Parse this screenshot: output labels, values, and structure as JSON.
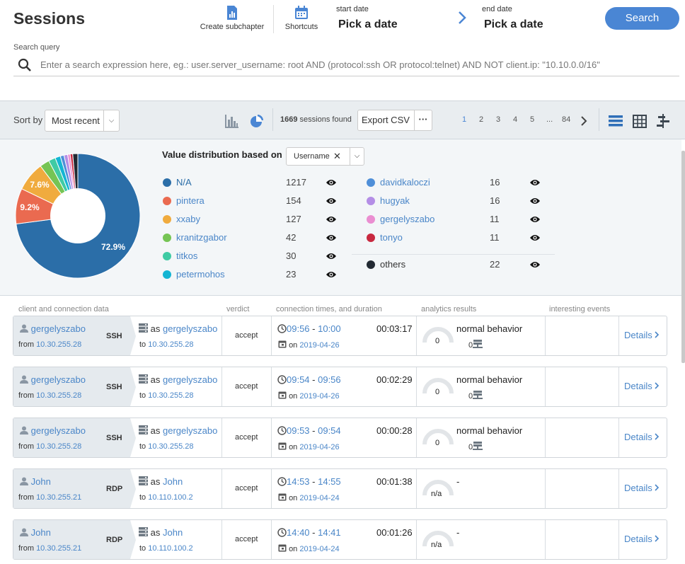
{
  "header": {
    "title": "Sessions",
    "create_subchapter": "Create subchapter",
    "shortcuts": "Shortcuts",
    "start_date_label": "start date",
    "start_date_value": "Pick a date",
    "end_date_label": "end date",
    "end_date_value": "Pick a date",
    "search_button": "Search",
    "search_query_label": "Search query",
    "search_placeholder": "Enter a search expression here, eg.: user.server_username: root AND (protocol:ssh OR protocol:telnet) AND NOT client.ip: \"10.10.0.0/16\""
  },
  "toolbar": {
    "sort_by": "Sort by",
    "sort_value": "Most recent",
    "sessions_count": "1669",
    "sessions_found": "sessions found",
    "export_csv": "Export CSV",
    "more": "···",
    "pages": [
      "1",
      "2",
      "3",
      "4",
      "5",
      "...",
      "84"
    ],
    "current_page": "1"
  },
  "distribution": {
    "label": "Value distribution based on",
    "field": "Username",
    "pie_labels": [
      "72.9%",
      "9.2%",
      "7.6%"
    ],
    "left": [
      {
        "name": "N/A",
        "count": "1217",
        "color": "#2b6ea8"
      },
      {
        "name": "pintera",
        "count": "154",
        "color": "#ea6a50"
      },
      {
        "name": "xxaby",
        "count": "127",
        "color": "#f0ab3e"
      },
      {
        "name": "kranitzgabor",
        "count": "42",
        "color": "#75c454"
      },
      {
        "name": "titkos",
        "count": "30",
        "color": "#3fcba4"
      },
      {
        "name": "petermohos",
        "count": "23",
        "color": "#14b5d3"
      }
    ],
    "right": [
      {
        "name": "davidkaloczi",
        "count": "16",
        "color": "#4f8fd8"
      },
      {
        "name": "hugyak",
        "count": "16",
        "color": "#b48ee6"
      },
      {
        "name": "gergelyszabo",
        "count": "11",
        "color": "#ea8ed1"
      },
      {
        "name": "tonyo",
        "count": "11",
        "color": "#c8283f"
      }
    ],
    "others": {
      "name": "others",
      "count": "22",
      "color": "#222a33"
    }
  },
  "columns": {
    "client": "client and connection data",
    "verdict": "verdict",
    "times": "connection times, and duration",
    "analytics": "analytics results",
    "events": "interesting events"
  },
  "sessions": [
    {
      "user": "gergelyszabo",
      "from_label": "from",
      "from_ip": "10.30.255.28",
      "protocol": "SSH",
      "as_label": "as",
      "as_user": "gergelyszabo",
      "to_label": "to",
      "to_ip": "10.30.255.28",
      "verdict": "accept",
      "start": "09:56",
      "end": "10:00",
      "duration": "00:03:17",
      "on_label": "on",
      "date": "2019-04-26",
      "score": "0",
      "behavior": "normal behavior",
      "count": "0",
      "details": "Details"
    },
    {
      "user": "gergelyszabo",
      "from_label": "from",
      "from_ip": "10.30.255.28",
      "protocol": "SSH",
      "as_label": "as",
      "as_user": "gergelyszabo",
      "to_label": "to",
      "to_ip": "10.30.255.28",
      "verdict": "accept",
      "start": "09:54",
      "end": "09:56",
      "duration": "00:02:29",
      "on_label": "on",
      "date": "2019-04-26",
      "score": "0",
      "behavior": "normal behavior",
      "count": "0",
      "details": "Details"
    },
    {
      "user": "gergelyszabo",
      "from_label": "from",
      "from_ip": "10.30.255.28",
      "protocol": "SSH",
      "as_label": "as",
      "as_user": "gergelyszabo",
      "to_label": "to",
      "to_ip": "10.30.255.28",
      "verdict": "accept",
      "start": "09:53",
      "end": "09:54",
      "duration": "00:00:28",
      "on_label": "on",
      "date": "2019-04-26",
      "score": "0",
      "behavior": "normal behavior",
      "count": "0",
      "details": "Details"
    },
    {
      "user": "John",
      "from_label": "from",
      "from_ip": "10.30.255.21",
      "protocol": "RDP",
      "as_label": "as",
      "as_user": "John",
      "to_label": "to",
      "to_ip": "10.110.100.2",
      "verdict": "accept",
      "start": "14:53",
      "end": "14:55",
      "duration": "00:01:38",
      "on_label": "on",
      "date": "2019-04-24",
      "score": "n/a",
      "behavior": "-",
      "count": "",
      "details": "Details"
    },
    {
      "user": "John",
      "from_label": "from",
      "from_ip": "10.30.255.21",
      "protocol": "RDP",
      "as_label": "as",
      "as_user": "John",
      "to_label": "to",
      "to_ip": "10.110.100.2",
      "verdict": "accept",
      "start": "14:40",
      "end": "14:41",
      "duration": "00:01:26",
      "on_label": "on",
      "date": "2019-04-24",
      "score": "n/a",
      "behavior": "-",
      "count": "",
      "details": "Details"
    }
  ]
}
